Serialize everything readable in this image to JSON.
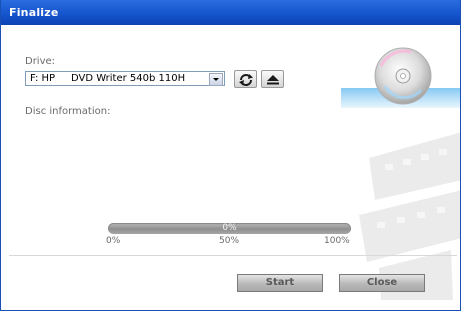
{
  "window": {
    "title": "Finalize"
  },
  "drive": {
    "label": "Drive:",
    "selected": "F: HP     DVD Writer 540b 110H"
  },
  "disc": {
    "label": "Disc information:"
  },
  "progress": {
    "value": 0,
    "text": "0%",
    "ticks": [
      "0%",
      "50%",
      "100%"
    ]
  },
  "buttons": {
    "start": "Start",
    "close": "Close"
  },
  "colors": {
    "titlebar": "#1453cc",
    "accent": "#3b74d6"
  },
  "icons": {
    "refresh": "refresh-icon",
    "eject": "eject-icon"
  }
}
